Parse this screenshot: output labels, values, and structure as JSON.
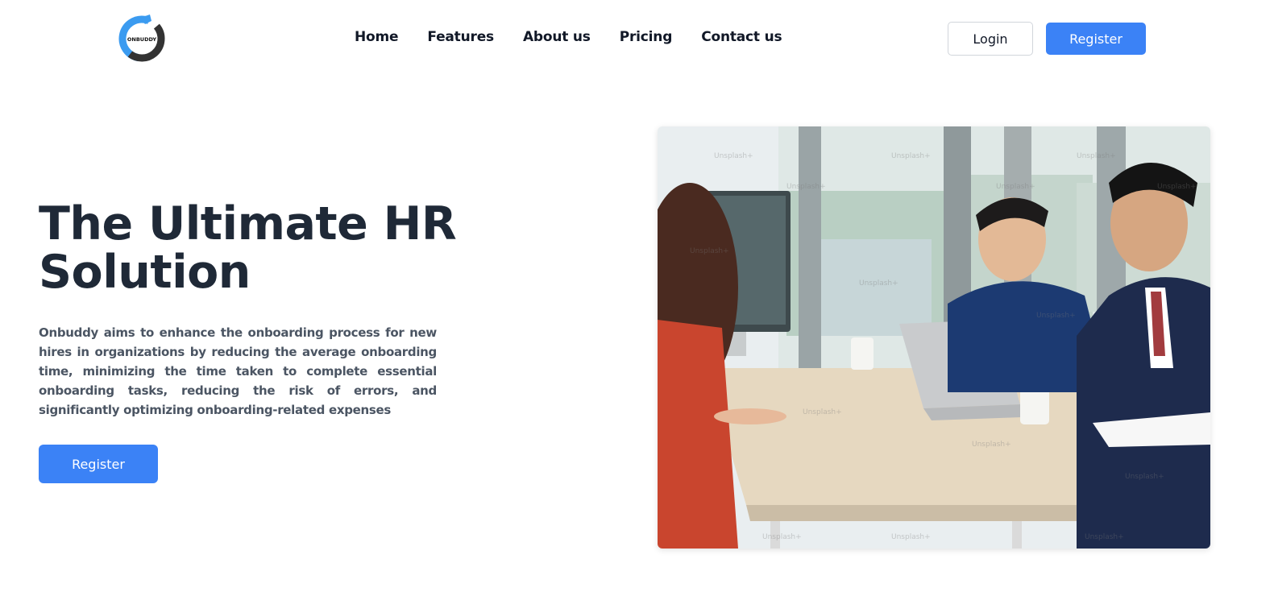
{
  "brand": {
    "logo_text": "ONBUDDY",
    "logo_color": "#3b9bf0"
  },
  "nav": {
    "items": [
      {
        "label": "Home"
      },
      {
        "label": "Features"
      },
      {
        "label": "About us"
      },
      {
        "label": "Pricing"
      },
      {
        "label": "Contact us"
      }
    ],
    "login_label": "Login",
    "register_label": "Register"
  },
  "hero": {
    "title": "The Ultimate HR Solution",
    "description": "Onbuddy aims to enhance the onboarding process for new hires in organizations by reducing the average onboarding time, minimizing the time taken to complete essential onboarding tasks, reducing the risk of errors, and significantly optimizing onboarding-related expenses",
    "register_label": "Register",
    "image_watermark": "Unsplash+"
  },
  "colors": {
    "accent": "#3b82f6",
    "title": "#1f2937",
    "body_text": "#4b5563"
  }
}
